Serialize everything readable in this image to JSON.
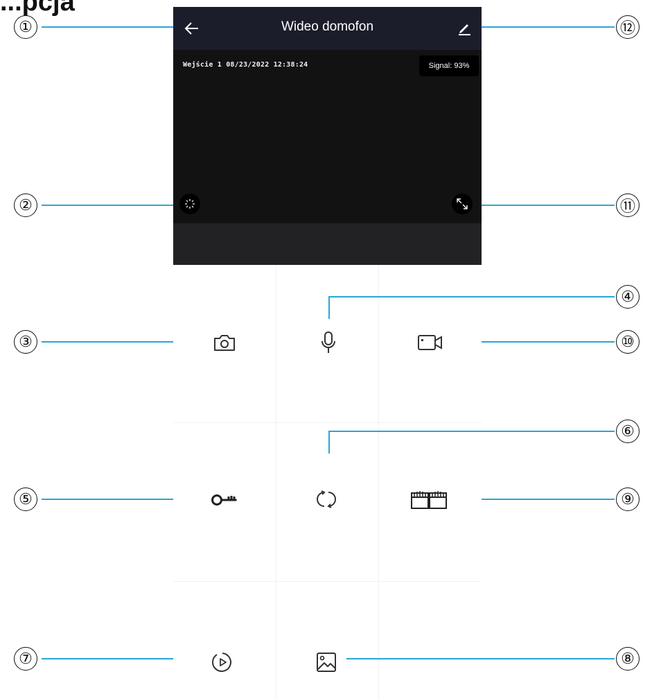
{
  "page": {
    "heading_fragment": "...pcja"
  },
  "header": {
    "title": "Wideo domofon",
    "back_icon": "arrow-left-icon",
    "edit_icon": "pencil-icon",
    "background": "#1c1d2b"
  },
  "video": {
    "overlay": "Wejście 1 08/23/2022  12:38:24",
    "signal": "Signal: 93%",
    "left_button_icon": "loading-spinner-icon",
    "right_button_icon": "fullscreen-expand-icon"
  },
  "controls": [
    {
      "id": "snapshot",
      "icon": "camera-icon"
    },
    {
      "id": "microphone",
      "icon": "microphone-icon"
    },
    {
      "id": "record",
      "icon": "video-camera-icon"
    },
    {
      "id": "unlock",
      "icon": "key-icon"
    },
    {
      "id": "switch",
      "icon": "switch-camera-icon"
    },
    {
      "id": "gate",
      "icon": "gate-icon"
    },
    {
      "id": "playback",
      "icon": "playback-icon"
    },
    {
      "id": "gallery",
      "icon": "image-icon"
    }
  ],
  "callouts": [
    "①",
    "②",
    "③",
    "④",
    "⑤",
    "⑥",
    "⑦",
    "⑧",
    "⑨",
    "⑩",
    "⑪",
    "⑫"
  ],
  "colors": {
    "callout_line": "#2aa6d6",
    "icon_stroke": "#333333"
  }
}
